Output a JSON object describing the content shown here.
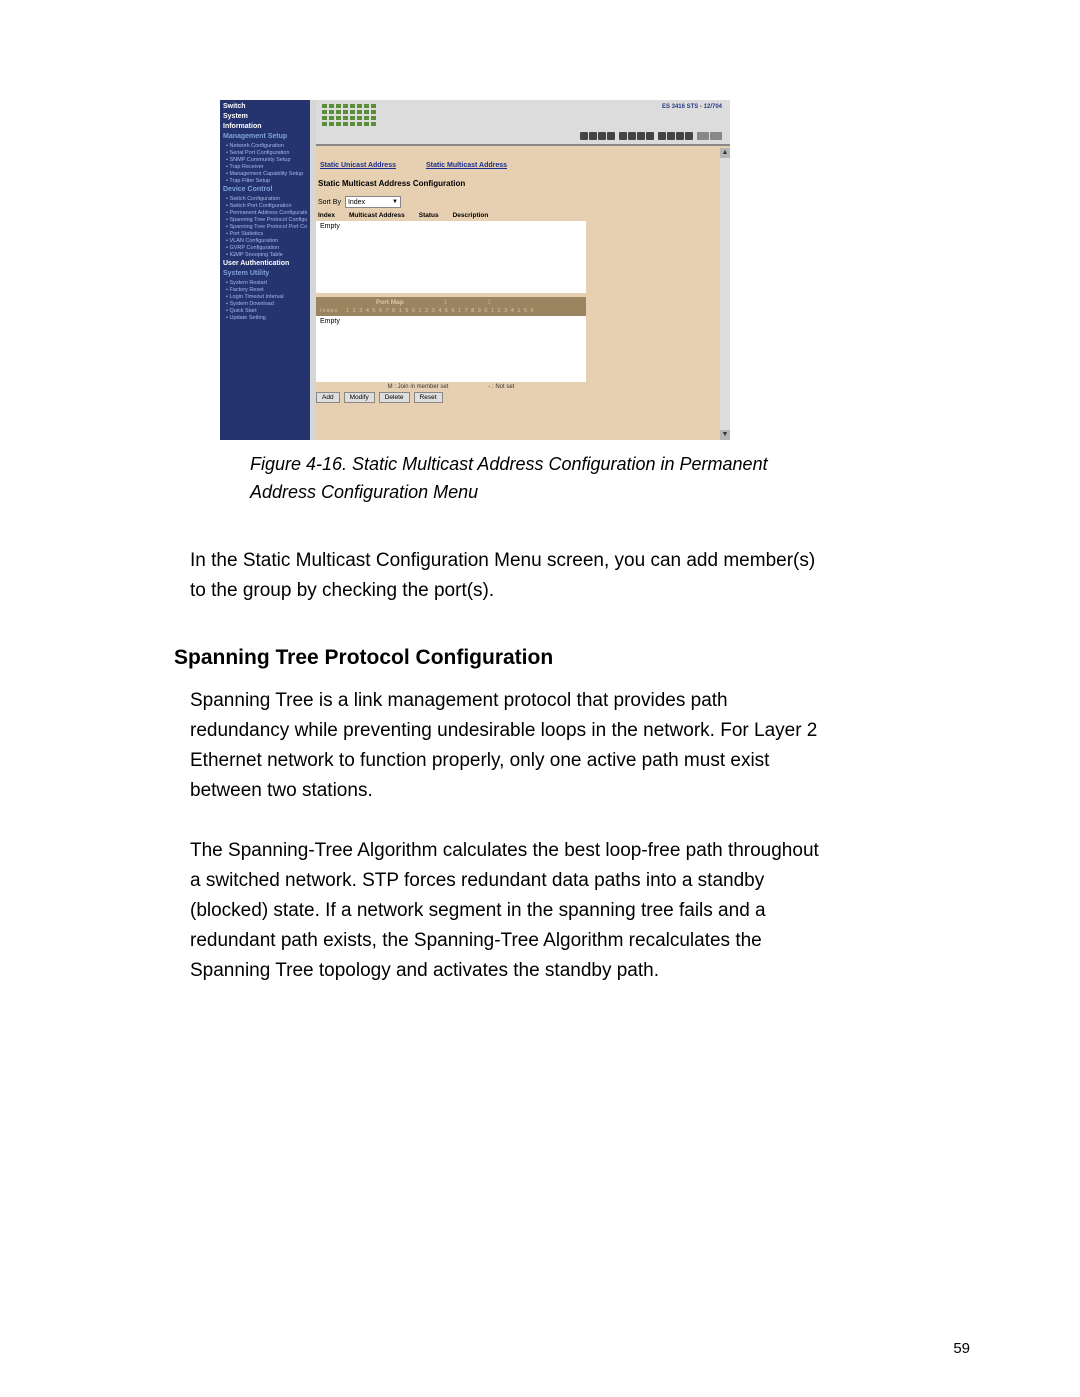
{
  "figure": {
    "caption": "Figure 4-16. Static Multicast Address Configuration in Permanent Address Configuration Menu",
    "sidebar": {
      "headers": [
        "Switch",
        "System",
        "Information",
        "Management Setup",
        "Device Control",
        "User Authentication",
        "System Utility"
      ],
      "items_setup": [
        "Network Configuration",
        "Serial Port Configuration",
        "SNMP Community Setup",
        "Trap Receiver",
        "Management Capability Setup",
        "Trap Filter Setup"
      ],
      "items_device": [
        "Switch Configuration",
        "Switch Port Configuration",
        "Permanent Address Configuration",
        "Spanning Tree Protocol Configuration",
        "Spanning Tree Protocol Port Configuration",
        "Port Statistics",
        "VLAN Configuration",
        "GVRP Configuration",
        "IGMP Snooping Table"
      ],
      "items_utility": [
        "System Restart",
        "Factory Reset",
        "Login Timeout Interval",
        "System Download",
        "Quick Start",
        "Update Setting"
      ]
    },
    "header": {
      "model": "ES 3416 STS - 12/704"
    },
    "main": {
      "tabs": {
        "unicast": "Static Unicast Address",
        "multicast": "Static Multicast Address"
      },
      "title": "Static Multicast Address Configuration",
      "sort_label": "Sort By",
      "sort_value": "Index",
      "columns": {
        "index": "Index",
        "addr": "Multicast Address",
        "status": "Status",
        "desc": "Description"
      },
      "empty": "Empty",
      "portmap_title": "Port Map",
      "portmap_index": "Index",
      "port_numbers": "1 2 3 4 5 6 7 8 1 9 0 1 2 3 4 5 6 1 7 8 9 0 1 2 3 4 1 5 6",
      "empty2": "Empty",
      "legend_m": "M : Join in member set",
      "legend_dash": "- : Not set",
      "buttons": {
        "add": "Add",
        "modify": "Modify",
        "delete": "Delete",
        "reset": "Reset"
      }
    }
  },
  "body": {
    "p1": "In the Static Multicast Configuration Menu screen, you can add member(s) to the group by checking the port(s).",
    "h2": "Spanning Tree Protocol Configuration",
    "p2": "Spanning Tree is a link management protocol that provides path redundancy while preventing undesirable loops in the network. For Layer 2 Ethernet network to function properly, only one active path must exist between two stations.",
    "p3": "The Spanning-Tree Algorithm calculates the best loop-free path throughout a switched network.  STP forces redundant data paths into a standby (blocked) state. If a network segment in the spanning tree fails and a redundant path exists, the Spanning-Tree Algorithm recalculates the Spanning Tree topology and activates the standby path."
  },
  "page_number": "59"
}
